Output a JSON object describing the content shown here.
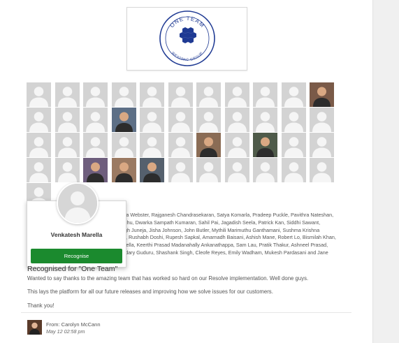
{
  "badge": {
    "top_text": "ONE TEAM",
    "bottom_text": "WESTPAC GROUP",
    "accent": "#1f3a93"
  },
  "grid": {
    "rows": [
      [
        "default",
        "default",
        "default",
        "default",
        "default",
        "default",
        "default",
        "default",
        "default",
        "default",
        "photo"
      ],
      [
        "default",
        "default",
        "default",
        "photo",
        "default",
        "default",
        "default",
        "default",
        "default",
        "default",
        "default"
      ],
      [
        "default",
        "default",
        "default",
        "default",
        "default",
        "default",
        "photo",
        "default",
        "photo",
        "default",
        "default"
      ],
      [
        "default",
        "default",
        "photo",
        "photo",
        "photo",
        "default",
        "default",
        "default",
        "default",
        "default",
        "default"
      ],
      [
        "default"
      ]
    ]
  },
  "names_lines": [
    "dra Webster, Rajganesh Chandrasekaran, Satya Komarla, Pradeep Puckle, Pavithra Nateshan,",
    "achu, Dwarka Sampath Kumaran, Sahil Pai, Jagadish Seela, Patrick Kan, Siddhi Sawant,",
    "ngh Juneja, Jisha Johnson, John Butler, Mythili Marimuthu Ganthamani, Sushma Krishna",
    "th, Rushabh Doshi, Rupesh Sapkal, Amarnadh Baisani, Ashish Mane, Robert Lo, Bismilah Khan,",
    "arella, Keerthi Prasad Madanahally Ankanathappa, Sam Lau, Pratik Thakur, Ashneel Prasad,",
    "wdary Guduru, Shashank Singh, Cleofe Reyes, Emily Wadham, Mukesh Pardasani and Jane"
  ],
  "popup": {
    "name": "Venkatesh Marella",
    "button_label": "Recognise",
    "button_color": "#1b8a2e"
  },
  "recognition": {
    "title": "Recognised for \"One Team\"",
    "line1": "Wanted to say thanks to the amazing team that has worked so hard on our Resolve implementation. Well done guys.",
    "line2": "This lays the platform for all our future releases and improving how we solve issues for our customers.",
    "line3": "Thank you!"
  },
  "sender": {
    "from_text": "From: Carolyn McCann",
    "date_text": "May 12 02:58 pm"
  }
}
